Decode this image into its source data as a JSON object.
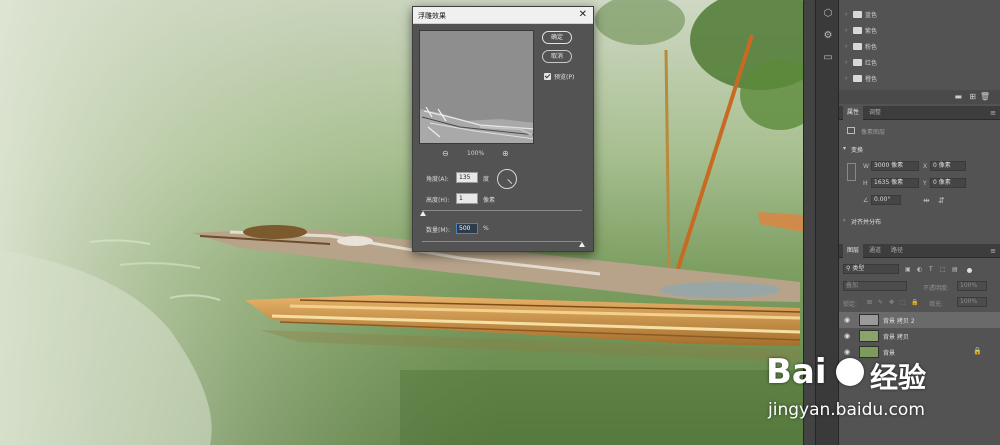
{
  "dialog": {
    "title": "浮雕效果",
    "ok_label": "确定",
    "cancel_label": "取消",
    "preview_label": "预览(P)",
    "preview_checked": true,
    "zoom_level": "100%",
    "angle": {
      "label": "角度(A):",
      "value": "135",
      "unit": "度"
    },
    "height": {
      "label": "高度(H):",
      "value": "1",
      "unit": "像素"
    },
    "amount": {
      "label": "数量(M):",
      "value": "500",
      "unit": "%"
    }
  },
  "swatches_panel": {
    "items": [
      {
        "label": "蓝色"
      },
      {
        "label": "紫色"
      },
      {
        "label": "粉色"
      },
      {
        "label": "红色"
      },
      {
        "label": "橙色"
      }
    ]
  },
  "properties_panel": {
    "tabs": [
      {
        "label": "属性"
      },
      {
        "label": "调整"
      }
    ],
    "subtitle": "像素图层",
    "transform_title": "变换",
    "w_label": "W",
    "w_value": "3000 像素",
    "x_label": "X",
    "x_value": "0 像素",
    "h_label": "H",
    "h_value": "1635 像素",
    "y_label": "Y",
    "y_value": "0 像素",
    "angle_value": "0.00°",
    "align_title": "对齐并分布"
  },
  "layers_panel": {
    "tabs": [
      {
        "label": "图层"
      },
      {
        "label": "通道"
      },
      {
        "label": "路径"
      }
    ],
    "filter_label": "类型",
    "blend_mode": "叠加",
    "opacity_label": "不透明度:",
    "opacity_value": "100%",
    "lock_label": "锁定:",
    "fill_label": "填充:",
    "fill_value": "100%",
    "layers": [
      {
        "name": "背景 拷贝 2",
        "active": true
      },
      {
        "name": "背景 拷贝",
        "active": false
      },
      {
        "name": "背景",
        "active": false,
        "locked": true
      }
    ]
  },
  "watermark": {
    "brand": "Bai",
    "brand_cn": "经验",
    "url": "jingyan.baidu.com"
  }
}
